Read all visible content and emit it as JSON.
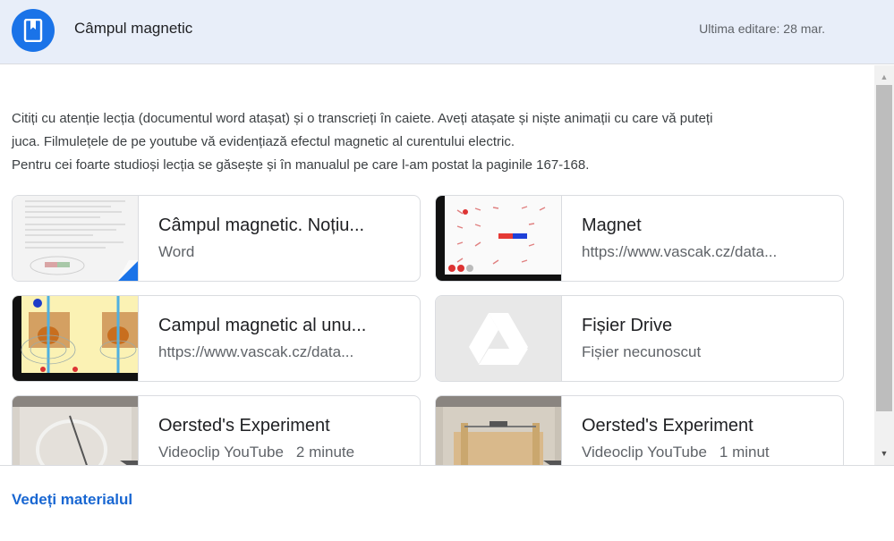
{
  "header": {
    "title": "Câmpul magnetic",
    "edited": "Ultima editare: 28 mar.",
    "icon": "assignment-bookmark-icon",
    "accent": "#1a73e8"
  },
  "description": {
    "line1": "Citiți cu atenție lecția (documentul word atașat) și o transcrieți în caiete. Aveți atașate și niște animații cu care vă puteți",
    "line2": "juca. Filmulețele de pe youtube vă evidențiază efectul magnetic al curentului electric.",
    "line3": "Pentru cei foarte studioși lecția se găsește și în manualul pe care l-am postat la paginile 167-168."
  },
  "attachments": [
    {
      "title": "Câmpul magnetic. Noțiu...",
      "subtitle": "Word",
      "duration": ""
    },
    {
      "title": "Magnet",
      "subtitle": "https://www.vascak.cz/data...",
      "duration": ""
    },
    {
      "title": "Campul magnetic al unu...",
      "subtitle": "https://www.vascak.cz/data...",
      "duration": ""
    },
    {
      "title": "Fișier Drive",
      "subtitle": "Fișier necunoscut",
      "duration": ""
    },
    {
      "title": "Oersted's Experiment",
      "subtitle": "Videoclip YouTube",
      "duration": "2 minute"
    },
    {
      "title": "Oersted's Experiment",
      "subtitle": "Videoclip YouTube",
      "duration": "1 minut"
    }
  ],
  "footer": {
    "link": "Vedeți materialul"
  }
}
